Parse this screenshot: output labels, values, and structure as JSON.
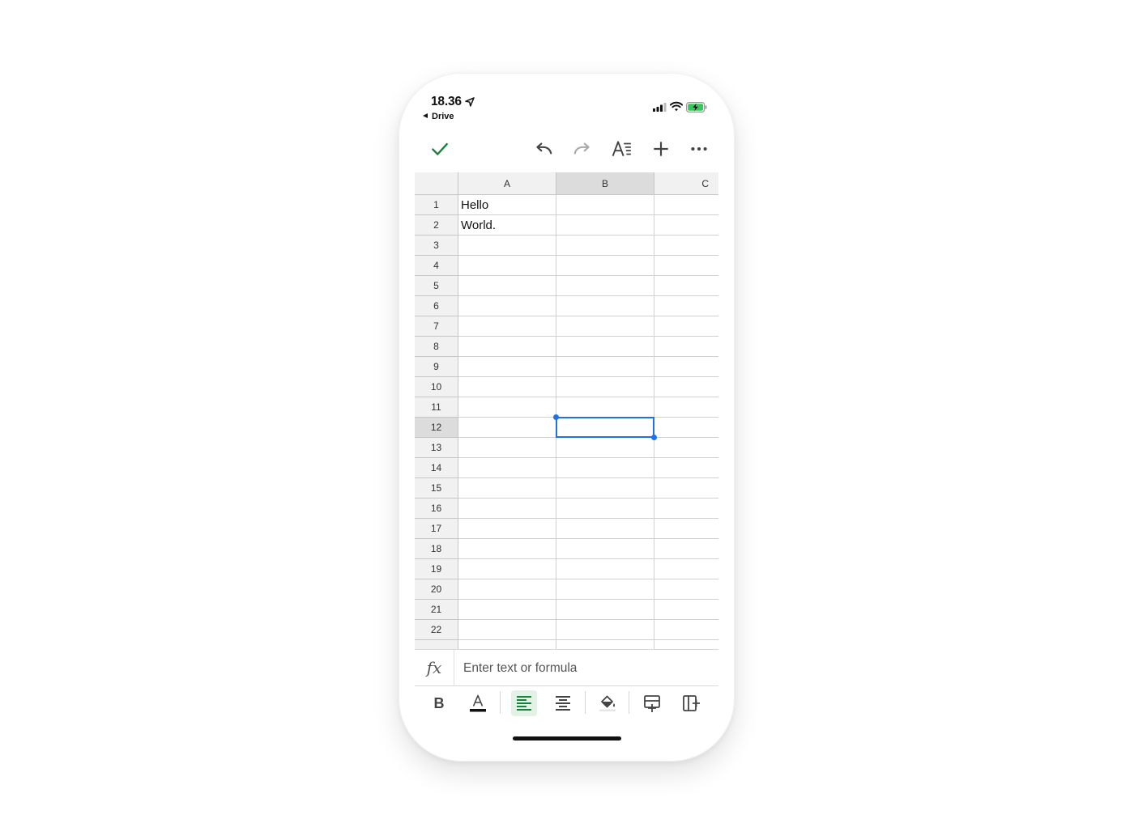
{
  "status_bar": {
    "time": "18.36",
    "back_label": "Drive"
  },
  "toolbar": {
    "accent": "#188038"
  },
  "sheet": {
    "columns": [
      "A",
      "B",
      "C"
    ],
    "rows": [
      "1",
      "2",
      "3",
      "4",
      "5",
      "6",
      "7",
      "8",
      "9",
      "10",
      "11",
      "12",
      "13",
      "14",
      "15",
      "16",
      "17",
      "18",
      "19",
      "20",
      "21",
      "22"
    ],
    "cells": {
      "A1": "Hello",
      "A2": "World."
    },
    "selected_cell": "B12",
    "selection_color": "#1a73e8"
  },
  "formula_bar": {
    "fx_label": "fx",
    "placeholder": "Enter text or formula",
    "value": ""
  },
  "format_bar": {
    "bold_label": "B"
  }
}
